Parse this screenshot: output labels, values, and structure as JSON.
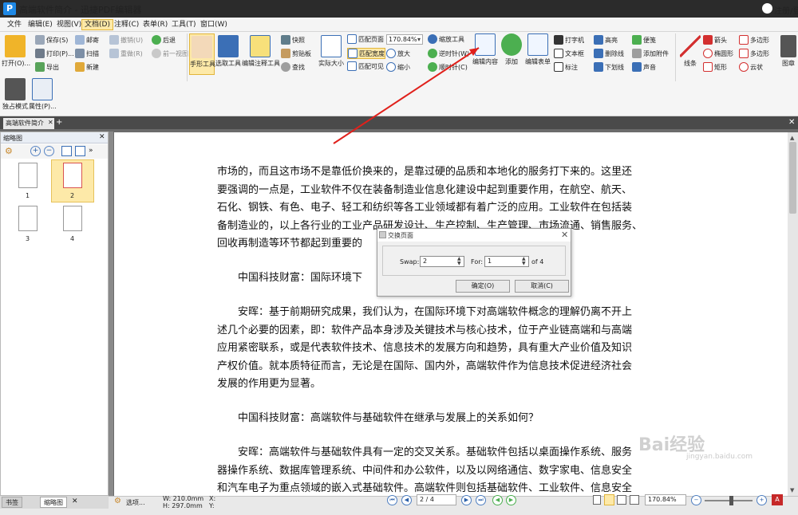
{
  "window": {
    "title": "高端软件简介 - 迅捷PDF编辑器",
    "app_icon": "P",
    "user_label": "注册/登"
  },
  "menu": [
    "文件",
    "编辑(E)",
    "视图(V)",
    "文档(D)",
    "注释(C)",
    "表单(R)",
    "工具(T)",
    "窗口(W)"
  ],
  "ribbon": {
    "open": "打开(O)...",
    "save": "保存(S)",
    "print": "打印(P)...",
    "export": "导出",
    "mail": "邮寄",
    "scan": "扫描",
    "new": "新建",
    "undo": "撤销(U)",
    "redo": "重做(R)",
    "back": "后退",
    "forward": "前一视图",
    "hand_tool": "手形工具",
    "select_tool": "选取工具",
    "edit_annot_tool": "编辑注释工具",
    "snapshot": "快照",
    "clipboard": "剪贴板",
    "find": "查找",
    "actual_size": "实际大小",
    "fit_page": "匹配页面",
    "fit_width": "匹配宽度",
    "fit_visible": "匹配可见",
    "zoom_value": "170.84%",
    "zoom_tool": "缩放工具",
    "zoom_in": "放大",
    "zoom_out": "缩小",
    "rotate_ccw": "逆时针(W)",
    "rotate_cw": "顺时针(C)",
    "edit_content": "编辑内容",
    "add": "添加",
    "edit_form": "编辑表单",
    "typewriter": "打字机",
    "textbox": "文本框",
    "callout": "标注",
    "highlight": "高亮",
    "strikeout": "删除线",
    "underline": "下划线",
    "note": "便笺",
    "attach": "添加附件",
    "sound": "声音",
    "line": "线条",
    "arrow": "箭头",
    "ellipse": "椭圆形",
    "rect": "矩形",
    "polygon": "多边形",
    "polyline": "多边形",
    "cloud": "云状",
    "stamp": "图章",
    "exclusive_mode": "独占模式",
    "properties": "属性(P)..."
  },
  "doc_tab": {
    "label": "高端软件简介"
  },
  "panel": {
    "title": "缩略图",
    "thumbnails": [
      "1",
      "2",
      "3",
      "4"
    ],
    "tabs": [
      "书签",
      "缩略图"
    ]
  },
  "document": {
    "paragraphs": [
      [
        "市场的，而且这市场不是靠低价换来的，是靠过硬的品质和本地化的服务打下来的。这里还",
        "要强调的一点是，工业软件不仅在装备制造业信息化建设中起到重要作用，在航空、航天、",
        "石化、钢铁、有色、电子、轻工和纺织等各工业领域都有着广泛的应用。工业软件在包括装",
        "备制造业的，以上各行业的工业产品研发设计、生产控制、生产管理、市场流通、销售服务、",
        "回收再制造等环节都起到重要的"
      ],
      [
        "　　中国科技财富：国际环境下"
      ],
      [
        "　　安晖：基于前期研究成果，我们认为，在国际环境下对高端软件概念的理解仍离不开上",
        "述几个必要的因素，即：软件产品本身涉及关键技术与核心技术，位于产业链高端和与高端",
        "应用紧密联系，或是代表软件技术、信息技术的发展方向和趋势，具有重大产业价值及知识",
        "产权价值。就本质特征而言，无论是在国际、国内外，高端软件作为信息技术促进经济社会",
        "发展的作用更为显著。"
      ],
      [
        "　　中国科技财富：高端软件与基础软件在继承与发展上的关系如何？"
      ],
      [
        "　　安晖：高端软件与基础软件具有一定的交叉关系。基础软件包括以桌面操作系统、服务",
        "器操作系统、数据库管理系统、中间件和办公软件，以及以网络通信、数字家电、信息安全",
        "和汽车电子为重点领域的嵌入式基础软件。高端软件则包括基础软件、工业软件、信息安全"
      ]
    ]
  },
  "dialog": {
    "title": "交换页面",
    "swap_label": "Swap:",
    "swap_value": "2",
    "for_label": "For:",
    "for_value": "1",
    "of_label": "of 4",
    "ok": "确定(O)",
    "cancel": "取消(C)"
  },
  "status": {
    "options": "选项...",
    "width": "W: 210.0mm",
    "height": "H: 297.0mm",
    "x": "X:",
    "y": "Y:",
    "page_value": "2 / 4",
    "zoom_value": "170.84%"
  },
  "watermark": {
    "text": "Bai经验",
    "sub": "jingyan.baidu.com"
  },
  "colors": {
    "accent": "#e2b53a",
    "selection": "#fde9a8",
    "arrow": "#e0201b",
    "titlebar": "#2b2b2b"
  }
}
